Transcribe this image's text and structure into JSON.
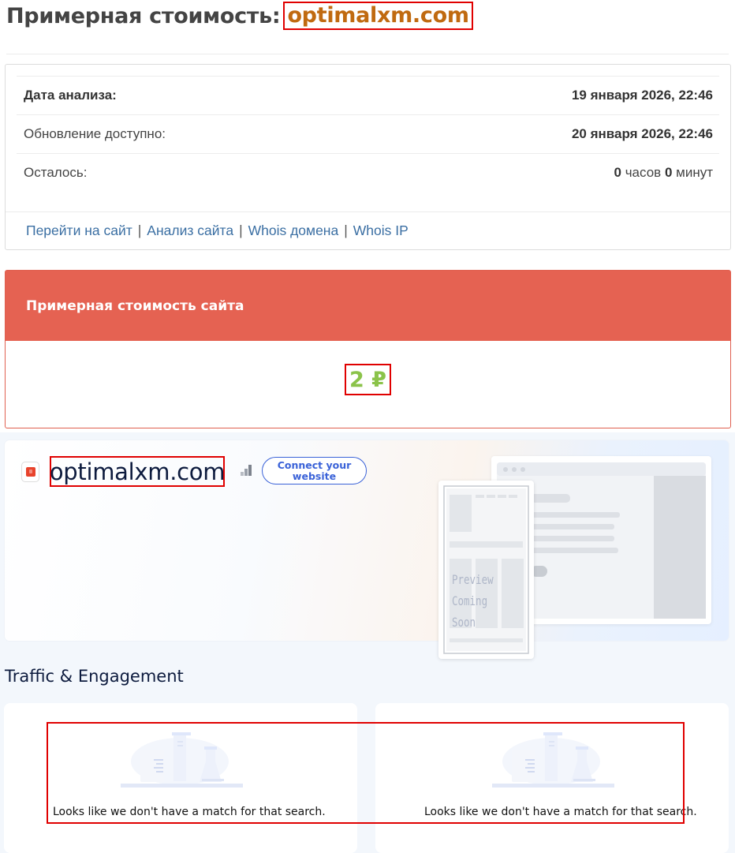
{
  "header": {
    "title_prefix": "Примерная стоимость:",
    "domain": "optimalxm.com"
  },
  "info": {
    "rows": [
      {
        "label": "Дата анализа:",
        "value": "19 января 2026, 22:46"
      },
      {
        "label": "Обновление доступно:",
        "value": "20 января 2026, 22:46"
      }
    ],
    "remaining": {
      "label": "Осталось:",
      "hours_value": "0",
      "hours_unit": "часов",
      "minutes_value": "0",
      "minutes_unit": "минут"
    },
    "links": [
      "Перейти на сайт",
      "Анализ сайта",
      "Whois домена",
      "Whois IP"
    ],
    "link_separator": "|"
  },
  "price": {
    "heading": "Примерная стоимость сайта",
    "value": "2 ₽"
  },
  "hero": {
    "domain": "optimalxm.com",
    "connect_label": "Connect your website",
    "preview_text_line1": "Preview",
    "preview_text_line2": "Coming Soon"
  },
  "traffic": {
    "title": "Traffic & Engagement",
    "cards": [
      {
        "message": "Looks like we don't have a match for that search."
      },
      {
        "message": "Looks like we don't have a match for that search."
      }
    ]
  },
  "colors": {
    "price_header": "#e56252",
    "price_value": "#8bc34a",
    "title_domain": "#c06a10",
    "link": "#3b6fa3",
    "accent_button": "#3a62d8",
    "highlight": "#e00000"
  }
}
